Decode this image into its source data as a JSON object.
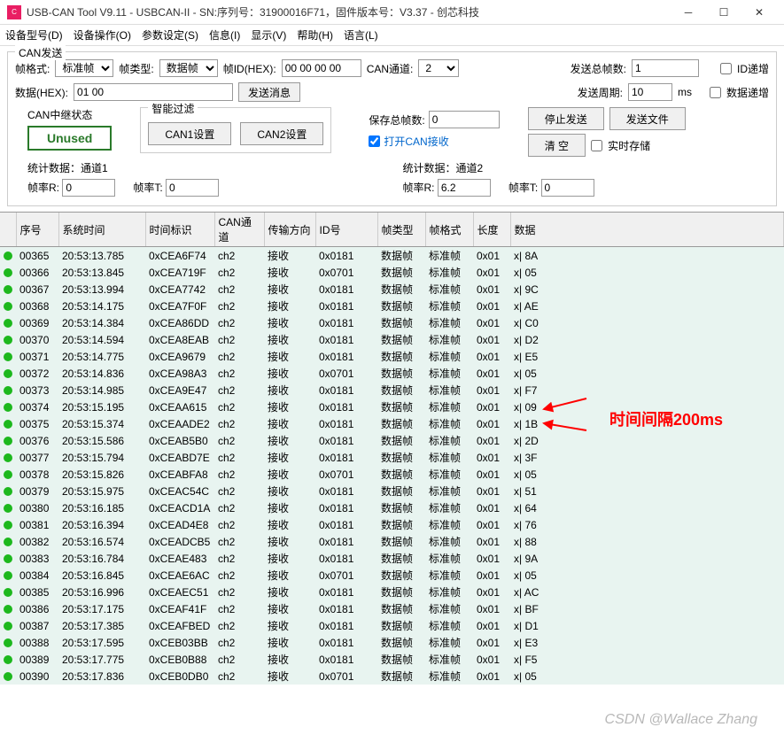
{
  "window": {
    "title": "USB-CAN Tool V9.11 - USBCAN-II - SN:序列号：31900016F71，固件版本号：V3.37 - 创芯科技"
  },
  "menu": {
    "m1": "设备型号(D)",
    "m2": "设备操作(O)",
    "m3": "参数设定(S)",
    "m4": "信息(I)",
    "m5": "显示(V)",
    "m6": "帮助(H)",
    "m7": "语言(L)"
  },
  "send": {
    "legend": "CAN发送",
    "frame_format_label": "帧格式:",
    "frame_format_value": "标准帧",
    "frame_type_label": "帧类型:",
    "frame_type_value": "数据帧",
    "frame_id_label": "帧ID(HEX):",
    "frame_id_value": "00 00 00 00",
    "channel_label": "CAN通道:",
    "channel_value": "2",
    "total_label": "发送总帧数:",
    "total_value": "1",
    "id_inc_label": "ID递增",
    "data_label": "数据(HEX):",
    "data_value": "01 00",
    "send_btn": "发送消息",
    "period_label": "发送周期:",
    "period_value": "10",
    "ms": "ms",
    "data_inc_label": "数据递增"
  },
  "relay": {
    "legend": "CAN中继状态",
    "unused": "Unused"
  },
  "filter": {
    "legend": "智能过滤",
    "can1": "CAN1设置",
    "can2": "CAN2设置"
  },
  "save": {
    "save_total_label": "保存总帧数:",
    "save_total_value": "0",
    "open_recv_label": "打开CAN接收"
  },
  "ctrl": {
    "stop": "停止发送",
    "sendfile": "发送文件",
    "clear": "清 空",
    "realtime": "实时存储"
  },
  "stats": {
    "ch1_head": "统计数据：通道1",
    "ch2_head": "统计数据：通道2",
    "rate_r_label": "帧率R:",
    "rate_t_label": "帧率T:",
    "ch1_r": "0",
    "ch1_t": "0",
    "ch2_r": "6.2",
    "ch2_t": "0"
  },
  "columns": {
    "c0": "",
    "c1": "序号",
    "c2": "系统时间",
    "c3": "时间标识",
    "c4": "CAN通道",
    "c5": "传输方向",
    "c6": "ID号",
    "c7": "帧类型",
    "c8": "帧格式",
    "c9": "长度",
    "c10": "数据"
  },
  "rows": [
    {
      "seq": "00365",
      "time": "20:53:13.785",
      "ts": "0xCEA6F74",
      "ch": "ch2",
      "dir": "接收",
      "id": "0x0181",
      "ftype": "数据帧",
      "ffmt": "标准帧",
      "len": "0x01",
      "data": "x| 8A"
    },
    {
      "seq": "00366",
      "time": "20:53:13.845",
      "ts": "0xCEA719F",
      "ch": "ch2",
      "dir": "接收",
      "id": "0x0701",
      "ftype": "数据帧",
      "ffmt": "标准帧",
      "len": "0x01",
      "data": "x| 05"
    },
    {
      "seq": "00367",
      "time": "20:53:13.994",
      "ts": "0xCEA7742",
      "ch": "ch2",
      "dir": "接收",
      "id": "0x0181",
      "ftype": "数据帧",
      "ffmt": "标准帧",
      "len": "0x01",
      "data": "x| 9C"
    },
    {
      "seq": "00368",
      "time": "20:53:14.175",
      "ts": "0xCEA7F0F",
      "ch": "ch2",
      "dir": "接收",
      "id": "0x0181",
      "ftype": "数据帧",
      "ffmt": "标准帧",
      "len": "0x01",
      "data": "x| AE"
    },
    {
      "seq": "00369",
      "time": "20:53:14.384",
      "ts": "0xCEA86DD",
      "ch": "ch2",
      "dir": "接收",
      "id": "0x0181",
      "ftype": "数据帧",
      "ffmt": "标准帧",
      "len": "0x01",
      "data": "x| C0"
    },
    {
      "seq": "00370",
      "time": "20:53:14.594",
      "ts": "0xCEA8EAB",
      "ch": "ch2",
      "dir": "接收",
      "id": "0x0181",
      "ftype": "数据帧",
      "ffmt": "标准帧",
      "len": "0x01",
      "data": "x| D2"
    },
    {
      "seq": "00371",
      "time": "20:53:14.775",
      "ts": "0xCEA9679",
      "ch": "ch2",
      "dir": "接收",
      "id": "0x0181",
      "ftype": "数据帧",
      "ffmt": "标准帧",
      "len": "0x01",
      "data": "x| E5"
    },
    {
      "seq": "00372",
      "time": "20:53:14.836",
      "ts": "0xCEA98A3",
      "ch": "ch2",
      "dir": "接收",
      "id": "0x0701",
      "ftype": "数据帧",
      "ffmt": "标准帧",
      "len": "0x01",
      "data": "x| 05"
    },
    {
      "seq": "00373",
      "time": "20:53:14.985",
      "ts": "0xCEA9E47",
      "ch": "ch2",
      "dir": "接收",
      "id": "0x0181",
      "ftype": "数据帧",
      "ffmt": "标准帧",
      "len": "0x01",
      "data": "x| F7"
    },
    {
      "seq": "00374",
      "time": "20:53:15.195",
      "ts": "0xCEAA615",
      "ch": "ch2",
      "dir": "接收",
      "id": "0x0181",
      "ftype": "数据帧",
      "ffmt": "标准帧",
      "len": "0x01",
      "data": "x| 09"
    },
    {
      "seq": "00375",
      "time": "20:53:15.374",
      "ts": "0xCEAADE2",
      "ch": "ch2",
      "dir": "接收",
      "id": "0x0181",
      "ftype": "数据帧",
      "ffmt": "标准帧",
      "len": "0x01",
      "data": "x| 1B"
    },
    {
      "seq": "00376",
      "time": "20:53:15.586",
      "ts": "0xCEAB5B0",
      "ch": "ch2",
      "dir": "接收",
      "id": "0x0181",
      "ftype": "数据帧",
      "ffmt": "标准帧",
      "len": "0x01",
      "data": "x| 2D"
    },
    {
      "seq": "00377",
      "time": "20:53:15.794",
      "ts": "0xCEABD7E",
      "ch": "ch2",
      "dir": "接收",
      "id": "0x0181",
      "ftype": "数据帧",
      "ffmt": "标准帧",
      "len": "0x01",
      "data": "x| 3F"
    },
    {
      "seq": "00378",
      "time": "20:53:15.826",
      "ts": "0xCEABFA8",
      "ch": "ch2",
      "dir": "接收",
      "id": "0x0701",
      "ftype": "数据帧",
      "ffmt": "标准帧",
      "len": "0x01",
      "data": "x| 05"
    },
    {
      "seq": "00379",
      "time": "20:53:15.975",
      "ts": "0xCEAC54C",
      "ch": "ch2",
      "dir": "接收",
      "id": "0x0181",
      "ftype": "数据帧",
      "ffmt": "标准帧",
      "len": "0x01",
      "data": "x| 51"
    },
    {
      "seq": "00380",
      "time": "20:53:16.185",
      "ts": "0xCEACD1A",
      "ch": "ch2",
      "dir": "接收",
      "id": "0x0181",
      "ftype": "数据帧",
      "ffmt": "标准帧",
      "len": "0x01",
      "data": "x| 64"
    },
    {
      "seq": "00381",
      "time": "20:53:16.394",
      "ts": "0xCEAD4E8",
      "ch": "ch2",
      "dir": "接收",
      "id": "0x0181",
      "ftype": "数据帧",
      "ffmt": "标准帧",
      "len": "0x01",
      "data": "x| 76"
    },
    {
      "seq": "00382",
      "time": "20:53:16.574",
      "ts": "0xCEADCB5",
      "ch": "ch2",
      "dir": "接收",
      "id": "0x0181",
      "ftype": "数据帧",
      "ffmt": "标准帧",
      "len": "0x01",
      "data": "x| 88"
    },
    {
      "seq": "00383",
      "time": "20:53:16.784",
      "ts": "0xCEAE483",
      "ch": "ch2",
      "dir": "接收",
      "id": "0x0181",
      "ftype": "数据帧",
      "ffmt": "标准帧",
      "len": "0x01",
      "data": "x| 9A"
    },
    {
      "seq": "00384",
      "time": "20:53:16.845",
      "ts": "0xCEAE6AC",
      "ch": "ch2",
      "dir": "接收",
      "id": "0x0701",
      "ftype": "数据帧",
      "ffmt": "标准帧",
      "len": "0x01",
      "data": "x| 05"
    },
    {
      "seq": "00385",
      "time": "20:53:16.996",
      "ts": "0xCEAEC51",
      "ch": "ch2",
      "dir": "接收",
      "id": "0x0181",
      "ftype": "数据帧",
      "ffmt": "标准帧",
      "len": "0x01",
      "data": "x| AC"
    },
    {
      "seq": "00386",
      "time": "20:53:17.175",
      "ts": "0xCEAF41F",
      "ch": "ch2",
      "dir": "接收",
      "id": "0x0181",
      "ftype": "数据帧",
      "ffmt": "标准帧",
      "len": "0x01",
      "data": "x| BF"
    },
    {
      "seq": "00387",
      "time": "20:53:17.385",
      "ts": "0xCEAFBED",
      "ch": "ch2",
      "dir": "接收",
      "id": "0x0181",
      "ftype": "数据帧",
      "ffmt": "标准帧",
      "len": "0x01",
      "data": "x| D1"
    },
    {
      "seq": "00388",
      "time": "20:53:17.595",
      "ts": "0xCEB03BB",
      "ch": "ch2",
      "dir": "接收",
      "id": "0x0181",
      "ftype": "数据帧",
      "ffmt": "标准帧",
      "len": "0x01",
      "data": "x| E3"
    },
    {
      "seq": "00389",
      "time": "20:53:17.775",
      "ts": "0xCEB0B88",
      "ch": "ch2",
      "dir": "接收",
      "id": "0x0181",
      "ftype": "数据帧",
      "ffmt": "标准帧",
      "len": "0x01",
      "data": "x| F5"
    },
    {
      "seq": "00390",
      "time": "20:53:17.836",
      "ts": "0xCEB0DB0",
      "ch": "ch2",
      "dir": "接收",
      "id": "0x0701",
      "ftype": "数据帧",
      "ffmt": "标准帧",
      "len": "0x01",
      "data": "x| 05"
    }
  ],
  "annotation": "时间间隔200ms",
  "watermark": "CSDN @Wallace Zhang"
}
